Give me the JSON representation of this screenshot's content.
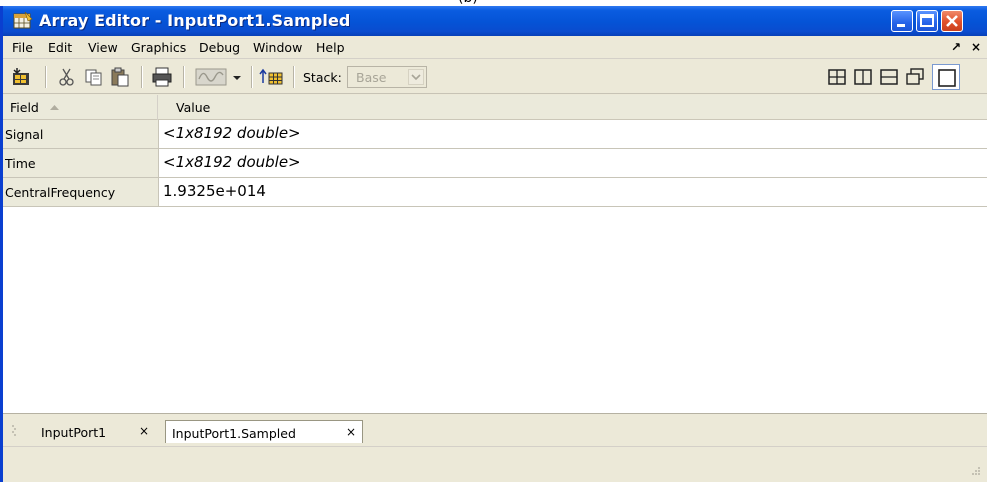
{
  "window": {
    "title": "Array Editor - InputPort1.Sampled"
  },
  "menubar": {
    "items": [
      "File",
      "Edit",
      "View",
      "Graphics",
      "Debug",
      "Window",
      "Help"
    ],
    "undock_glyph": "↗",
    "close_glyph": "×"
  },
  "toolbar": {
    "stack_label": "Stack:",
    "stack_value": "Base",
    "icons": [
      "import-data-icon",
      "cut-icon",
      "copy-icon",
      "paste-icon",
      "print-icon",
      "plot-icon",
      "plot-dropdown-icon",
      "go-up-icon",
      "tile-icon",
      "split-vertical-icon",
      "split-horizontal-icon",
      "float-icon",
      "maximize-icon"
    ]
  },
  "grid": {
    "columns": [
      "Field",
      "Value"
    ],
    "rows": [
      {
        "field": "Signal",
        "value": "<1x8192 double>",
        "italic": true
      },
      {
        "field": "Time",
        "value": "<1x8192 double>",
        "italic": true
      },
      {
        "field": "CentralFrequency",
        "value": "1.9325e+014",
        "italic": false
      }
    ]
  },
  "tabs": [
    {
      "label": "InputPort1",
      "close": "×",
      "active": false
    },
    {
      "label": "InputPort1.Sampled",
      "close": "×",
      "active": true
    }
  ],
  "colors": {
    "titlebar": "#0553d6",
    "close_button": "#e0502a",
    "chrome": "#ece9d8"
  }
}
